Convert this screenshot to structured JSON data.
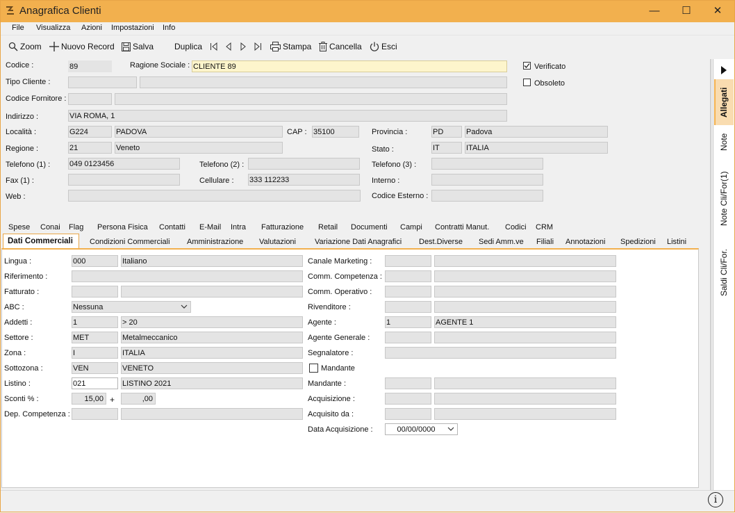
{
  "window": {
    "title": "Anagrafica Clienti",
    "minimize": "—",
    "maximize": "☐",
    "close": "✕"
  },
  "menu": [
    "File",
    "Visualizza",
    "Azioni",
    "Impostazioni",
    "Info"
  ],
  "toolbar": {
    "zoom": "Zoom",
    "new_record": "Nuovo Record",
    "save": "Salva",
    "duplicate": "Duplica",
    "print": "Stampa",
    "delete": "Cancella",
    "exit": "Esci"
  },
  "header": {
    "codice_label": "Codice :",
    "codice": "89",
    "ragione_label": "Ragione Sociale :",
    "ragione": "CLIENTE 89",
    "verificato_label": "Verificato",
    "verificato": true,
    "obsoleto_label": "Obsoleto",
    "obsoleto": false,
    "tipo_label": "Tipo Cliente :",
    "fornitore_label": "Codice Fornitore :",
    "indirizzo_label": "Indirizzo :",
    "indirizzo": "VIA ROMA, 1",
    "localita_label": "Località :",
    "localita_code": "G224",
    "localita": "PADOVA",
    "cap_label": "CAP :",
    "cap": "35100",
    "provincia_label": "Provincia :",
    "provincia_code": "PD",
    "provincia": "Padova",
    "regione_label": "Regione :",
    "regione_code": "21",
    "regione": "Veneto",
    "stato_label": "Stato :",
    "stato_code": "IT",
    "stato": "ITALIA",
    "tel1_label": "Telefono (1) :",
    "tel1": "049 0123456",
    "tel2_label": "Telefono (2) :",
    "tel2": "",
    "tel3_label": "Telefono (3) :",
    "tel3": "",
    "fax_label": "Fax (1) :",
    "fax": "",
    "cell_label": "Cellulare :",
    "cell": "333 112233",
    "interno_label": "Interno :",
    "interno": "",
    "web_label": "Web :",
    "web": "",
    "esterno_label": "Codice Esterno :",
    "esterno": ""
  },
  "tabs_row1": [
    "Spese",
    "Conai",
    "Flag",
    "Persona Fisica",
    "Contatti",
    "E-Mail",
    "Intra",
    "Fatturazione",
    "Retail",
    "Documenti",
    "Campi",
    "Contratti Manut.",
    "Codici",
    "CRM"
  ],
  "tabs_row2": [
    "Dati Commerciali",
    "Condizioni Commerciali",
    "Amministrazione",
    "Valutazioni",
    "Variazione Dati Anagrafici",
    "Dest.Diverse",
    "Sedi Amm.ve",
    "Filiali",
    "Annotazioni",
    "Spedizioni",
    "Listini"
  ],
  "left": {
    "lingua_label": "Lingua :",
    "lingua_code": "000",
    "lingua": "Italiano",
    "riferimento_label": "Riferimento :",
    "fatturato_label": "Fatturato :",
    "abc_label": "ABC :",
    "abc": "Nessuna",
    "addetti_label": "Addetti :",
    "addetti_code": "1",
    "addetti": "> 20",
    "settore_label": "Settore :",
    "settore_code": "MET",
    "settore": "Metalmeccanico",
    "zona_label": "Zona :",
    "zona_code": "I",
    "zona": "ITALIA",
    "sottozona_label": "Sottozona :",
    "sottozona_code": "VEN",
    "sottozona": "VENETO",
    "listino_label": "Listino :",
    "listino_code": "021",
    "listino": "LISTINO 2021",
    "sconti_label": "Sconti % :",
    "sconto1": "15,00",
    "plus": "+",
    "sconto2": ",00",
    "dep_label": "Dep. Competenza :"
  },
  "right": {
    "canale_label": "Canale Marketing :",
    "comm_comp_label": "Comm. Competenza :",
    "comm_oper_label": "Comm. Operativo :",
    "rivenditore_label": "Rivenditore :",
    "agente_label": "Agente :",
    "agente_code": "1",
    "agente": "AGENTE 1",
    "agente_gen_label": "Agente Generale :",
    "segnalatore_label": "Segnalatore :",
    "mandante_chk_label": "Mandante",
    "mandante_label": "Mandante :",
    "acquisizione_label": "Acquisizione :",
    "acquisito_label": "Acquisito da :",
    "data_acq_label": "Data Acquisizione :",
    "data_acq": "00/00/0000"
  },
  "side_tabs": [
    "Allegati",
    "Note",
    "Note Cli/For(1)",
    "Saldi Cli/For."
  ],
  "colors": {
    "accent": "#f2b04e",
    "field_bg": "#e4e4e4",
    "highlight": "#fdf5cc"
  }
}
